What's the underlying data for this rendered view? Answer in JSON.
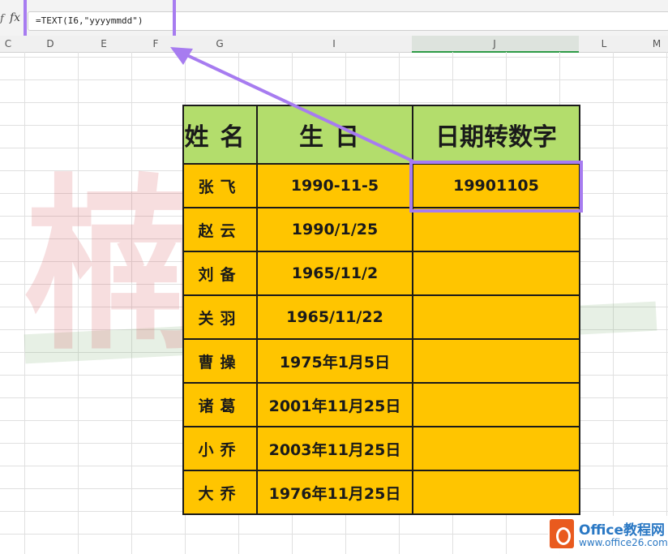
{
  "formula_bar": {
    "fx_left": "ƒ",
    "fx_symbol": "fx",
    "formula": "=TEXT(I6,\"yyyymmdd\")"
  },
  "columns": [
    "C",
    "D",
    "E",
    "F",
    "G",
    "I",
    "J",
    "L",
    "M"
  ],
  "table": {
    "headers": [
      "姓名",
      "生日",
      "日期转数字"
    ],
    "rows": [
      {
        "name": "张飞",
        "birthday": "1990-11-5",
        "number": "19901105"
      },
      {
        "name": "赵云",
        "birthday": "1990/1/25",
        "number": ""
      },
      {
        "name": "刘备",
        "birthday": "1965/11/2",
        "number": ""
      },
      {
        "name": "关羽",
        "birthday": "1965/11/22",
        "number": ""
      },
      {
        "name": "曹操",
        "birthday": "1975年1月5日",
        "number": ""
      },
      {
        "name": "诸葛",
        "birthday": "2001年11月25日",
        "number": ""
      },
      {
        "name": "小乔",
        "birthday": "2003年11月25日",
        "number": ""
      },
      {
        "name": "大乔",
        "birthday": "1976年11月25日",
        "number": ""
      }
    ]
  },
  "watermark": "楠GO",
  "logo": {
    "title": "Office教程网",
    "url": "www.office26.com"
  },
  "colors": {
    "header_fill": "#b3dd6c",
    "row_fill": "#ffc500",
    "highlight": "#a77cf0",
    "selected_column_border": "#2e9b46"
  }
}
